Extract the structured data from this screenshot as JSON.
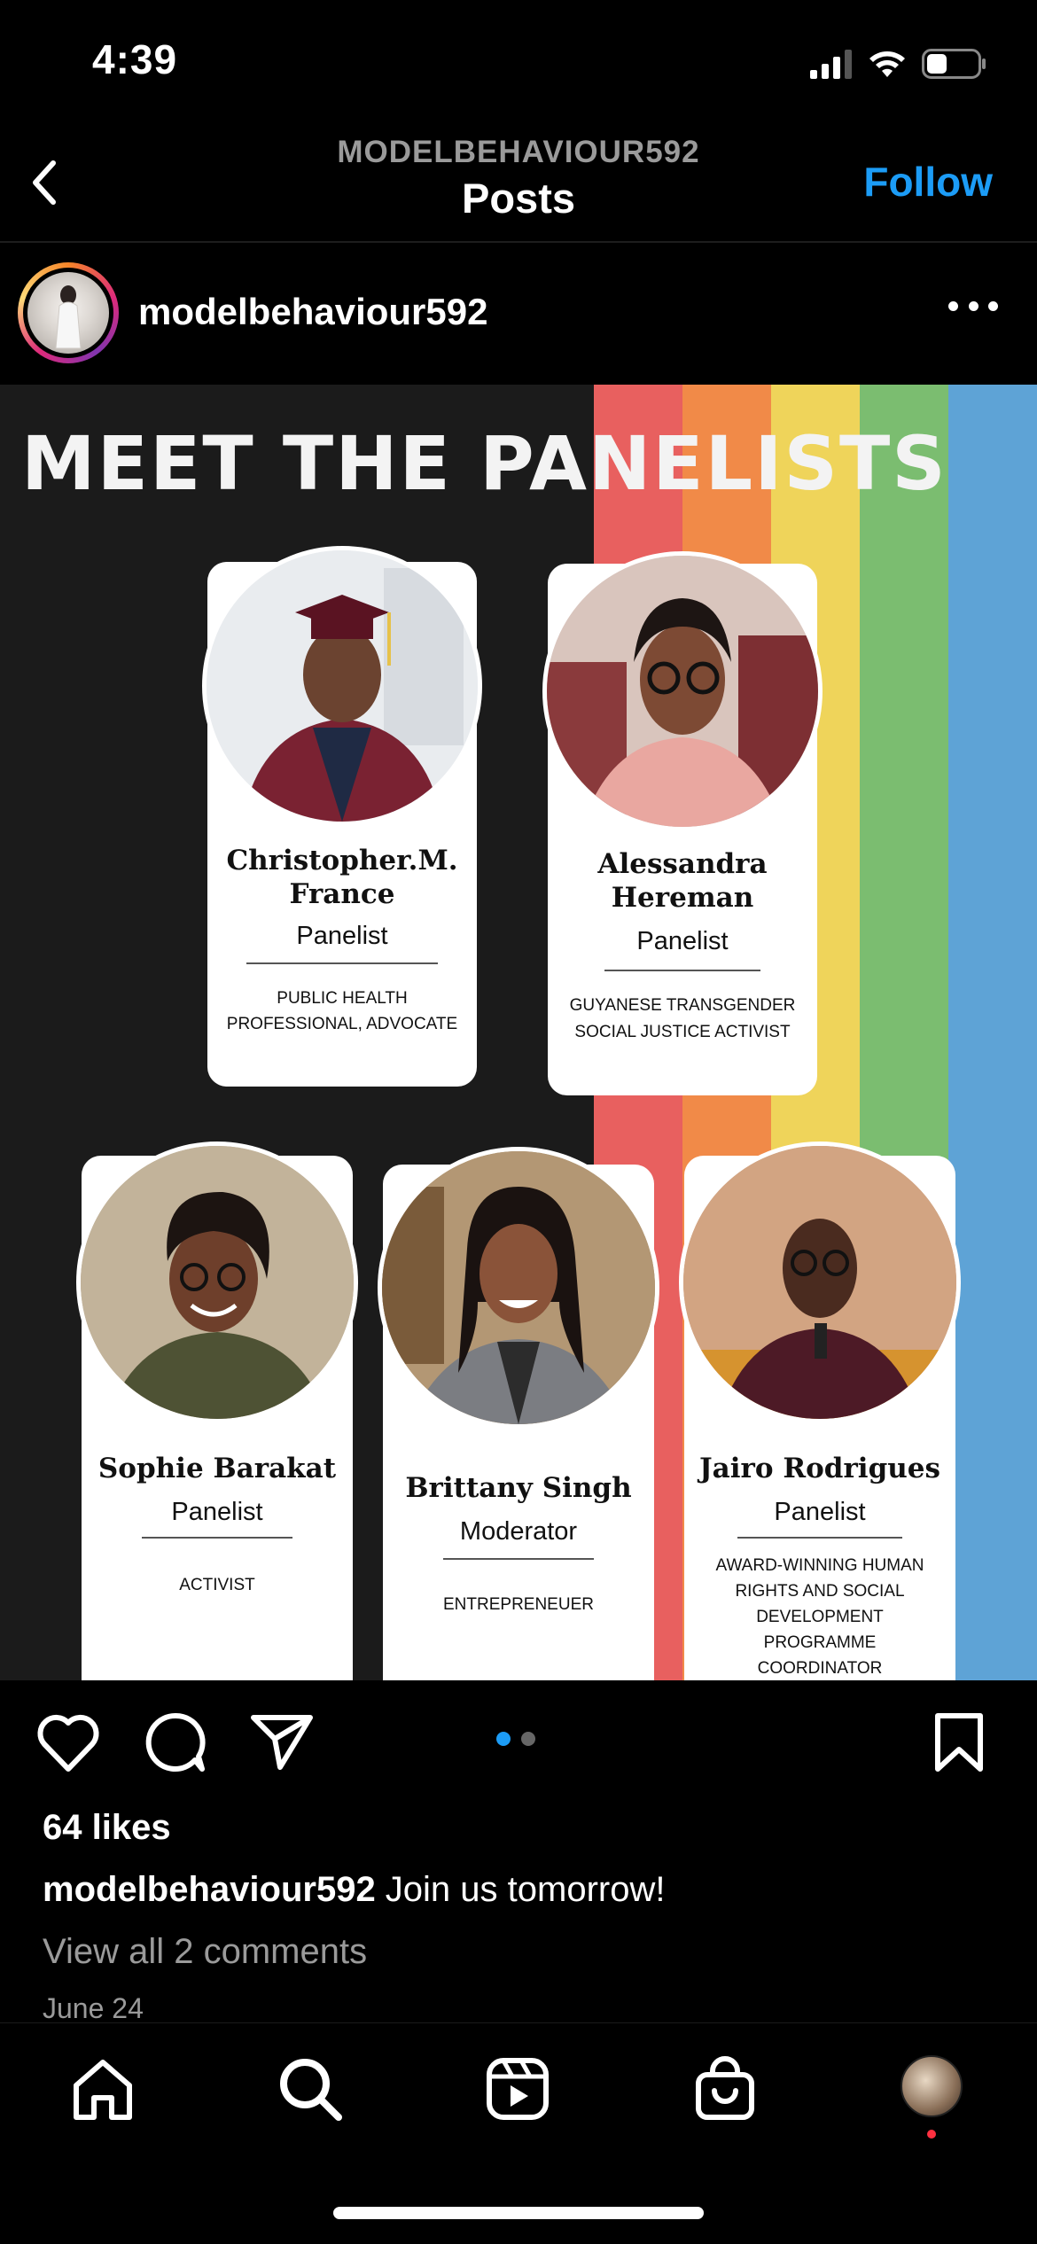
{
  "status_bar": {
    "time": "4:39"
  },
  "header": {
    "username": "MODELBEHAVIOUR592",
    "title": "Posts",
    "follow_label": "Follow"
  },
  "post": {
    "author": "modelbehaviour592",
    "image": {
      "heading": "MEET THE  PANELISTS",
      "stripe_colors": [
        "#e8605f",
        "#f18a48",
        "#efd45a",
        "#7bbd70",
        "#5ea3d6"
      ],
      "panelists": [
        {
          "name_line1": "Christopher.M.",
          "name_line2": "France",
          "role": "Panelist",
          "desc_line1": "PUBLIC HEALTH",
          "desc_line2": "PROFESSIONAL, ADVOCATE",
          "desc_line3": "",
          "desc_line4": "",
          "desc_line5": ""
        },
        {
          "name_line1": "Alessandra",
          "name_line2": "Hereman",
          "role": "Panelist",
          "desc_line1": "GUYANESE TRANSGENDER",
          "desc_line2": "SOCIAL JUSTICE ACTIVIST",
          "desc_line3": "",
          "desc_line4": "",
          "desc_line5": ""
        },
        {
          "name_line1": "Sophie Barakat",
          "name_line2": "",
          "role": "Panelist",
          "desc_line1": "ACTIVIST",
          "desc_line2": "",
          "desc_line3": "",
          "desc_line4": "",
          "desc_line5": ""
        },
        {
          "name_line1": "Brittany Singh",
          "name_line2": "",
          "role": "Moderator",
          "desc_line1": "ENTREPRENEUER",
          "desc_line2": "",
          "desc_line3": "",
          "desc_line4": "",
          "desc_line5": ""
        },
        {
          "name_line1": "Jairo Rodrigues",
          "name_line2": "",
          "role": "Panelist",
          "desc_line1": "AWARD-WINNING HUMAN",
          "desc_line2": "RIGHTS AND SOCIAL",
          "desc_line3": "DEVELOPMENT",
          "desc_line4": "PROGRAMME",
          "desc_line5": "COORDINATOR"
        }
      ]
    },
    "carousel": {
      "count": 2,
      "active": 1
    },
    "likes": "64 likes",
    "caption_user": "modelbehaviour592",
    "caption_text": " Join us tomorrow!",
    "comments_link": "View all 2 comments",
    "date": "June 24"
  },
  "colors": {
    "accent": "#1c9cf6",
    "muted": "#9a9a9a",
    "background": "#000000"
  },
  "icons": [
    "back-chevron-icon",
    "more-icon",
    "heart-icon",
    "comment-icon",
    "share-icon",
    "bookmark-icon",
    "home-icon",
    "search-icon",
    "reels-icon",
    "shop-icon",
    "profile-avatar"
  ]
}
